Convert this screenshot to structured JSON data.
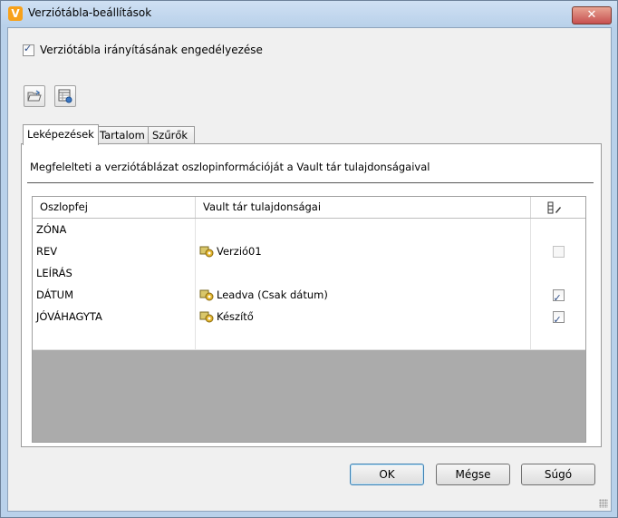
{
  "window": {
    "title": "Verziótábla-beállítások",
    "app_icon_letter": "V",
    "close_label": "✕"
  },
  "enable_checkbox": {
    "label": "Verziótábla irányításának engedélyezése",
    "checked": true
  },
  "toolbar": {
    "buttons": [
      {
        "name": "open-folder-icon"
      },
      {
        "name": "table-settings-icon"
      }
    ]
  },
  "tabs": [
    {
      "label": "Leképezések",
      "active": true
    },
    {
      "label": "Tartalom",
      "active": false
    },
    {
      "label": "Szűrők",
      "active": false
    }
  ],
  "mapping_panel": {
    "description": "Megfelelteti a verziótáblázat oszlopinformációját a Vault tár tulajdonságaival",
    "columns": {
      "col1": "Oszlopfej",
      "col2": "Vault tár tulajdonságai",
      "col3_icon": "column-edit-icon"
    },
    "rows": [
      {
        "header": "ZÓNA",
        "property": "",
        "checkbox": "none"
      },
      {
        "header": "REV",
        "property": "Verzió01",
        "checkbox": "disabled"
      },
      {
        "header": "LEÍRÁS",
        "property": "",
        "checkbox": "none"
      },
      {
        "header": "DÁTUM",
        "property": "Leadva (Csak dátum)",
        "checkbox": "checked"
      },
      {
        "header": "JÓVÁHAGYTA",
        "property": "Készítő",
        "checkbox": "checked"
      }
    ]
  },
  "buttons": {
    "ok": "OK",
    "cancel": "Mégse",
    "help": "Súgó"
  },
  "colors": {
    "title_bar": "#b9d1ea",
    "dialog_bg": "#f0f0f0",
    "grid_empty": "#ababab",
    "close_button": "#c75050"
  }
}
